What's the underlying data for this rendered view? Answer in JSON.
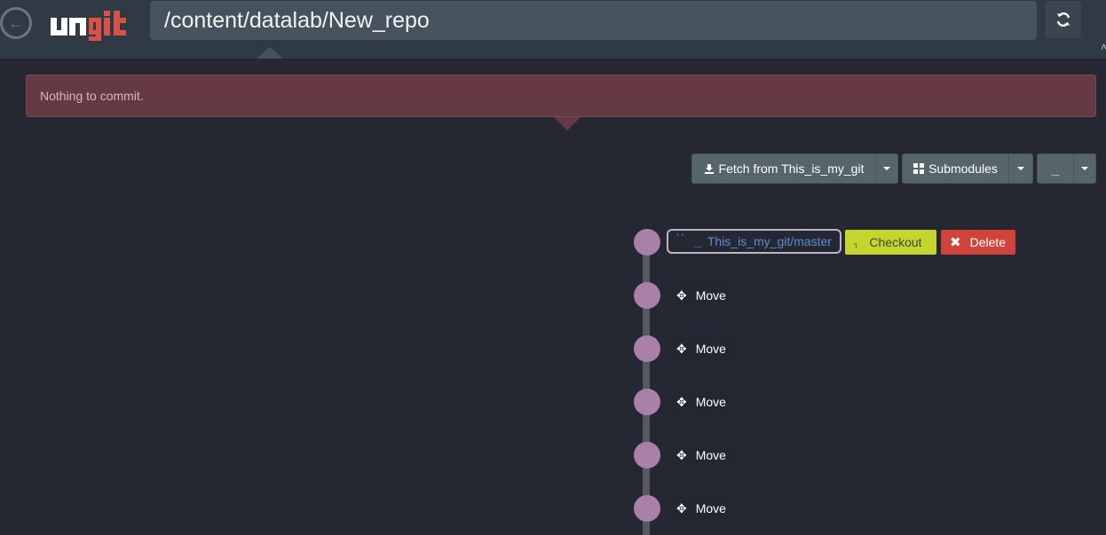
{
  "header": {
    "logo_text": "ungit",
    "repo_path": "/content/datalab/New_repo",
    "edge_glyph": "˄"
  },
  "banner": {
    "message": "Nothing to commit."
  },
  "toolbar": {
    "fetch_label": "Fetch from This_is_my_git",
    "submodules_label": "Submodules",
    "branch_glyph": "⎽"
  },
  "graph": {
    "ref": {
      "glyph_a": "ᶜᶜ",
      "glyph_b": "⎽",
      "label": "This_is_my_git/master"
    },
    "checkout": {
      "glyph": "┐",
      "label": "Checkout"
    },
    "delete_label": "Delete",
    "move_buttons": [
      {
        "label": "Move"
      },
      {
        "label": "Move"
      },
      {
        "label": "Move"
      },
      {
        "label": "Move"
      },
      {
        "label": "Move"
      }
    ]
  },
  "colors": {
    "background": "#252833",
    "header": "#2f3a45",
    "banner": "#653a44",
    "node": "#a981a8",
    "checkout": "#c4d62e",
    "delete": "#d0433b",
    "ref_text": "#5b8bd5",
    "logo_red": "#d9524a"
  }
}
